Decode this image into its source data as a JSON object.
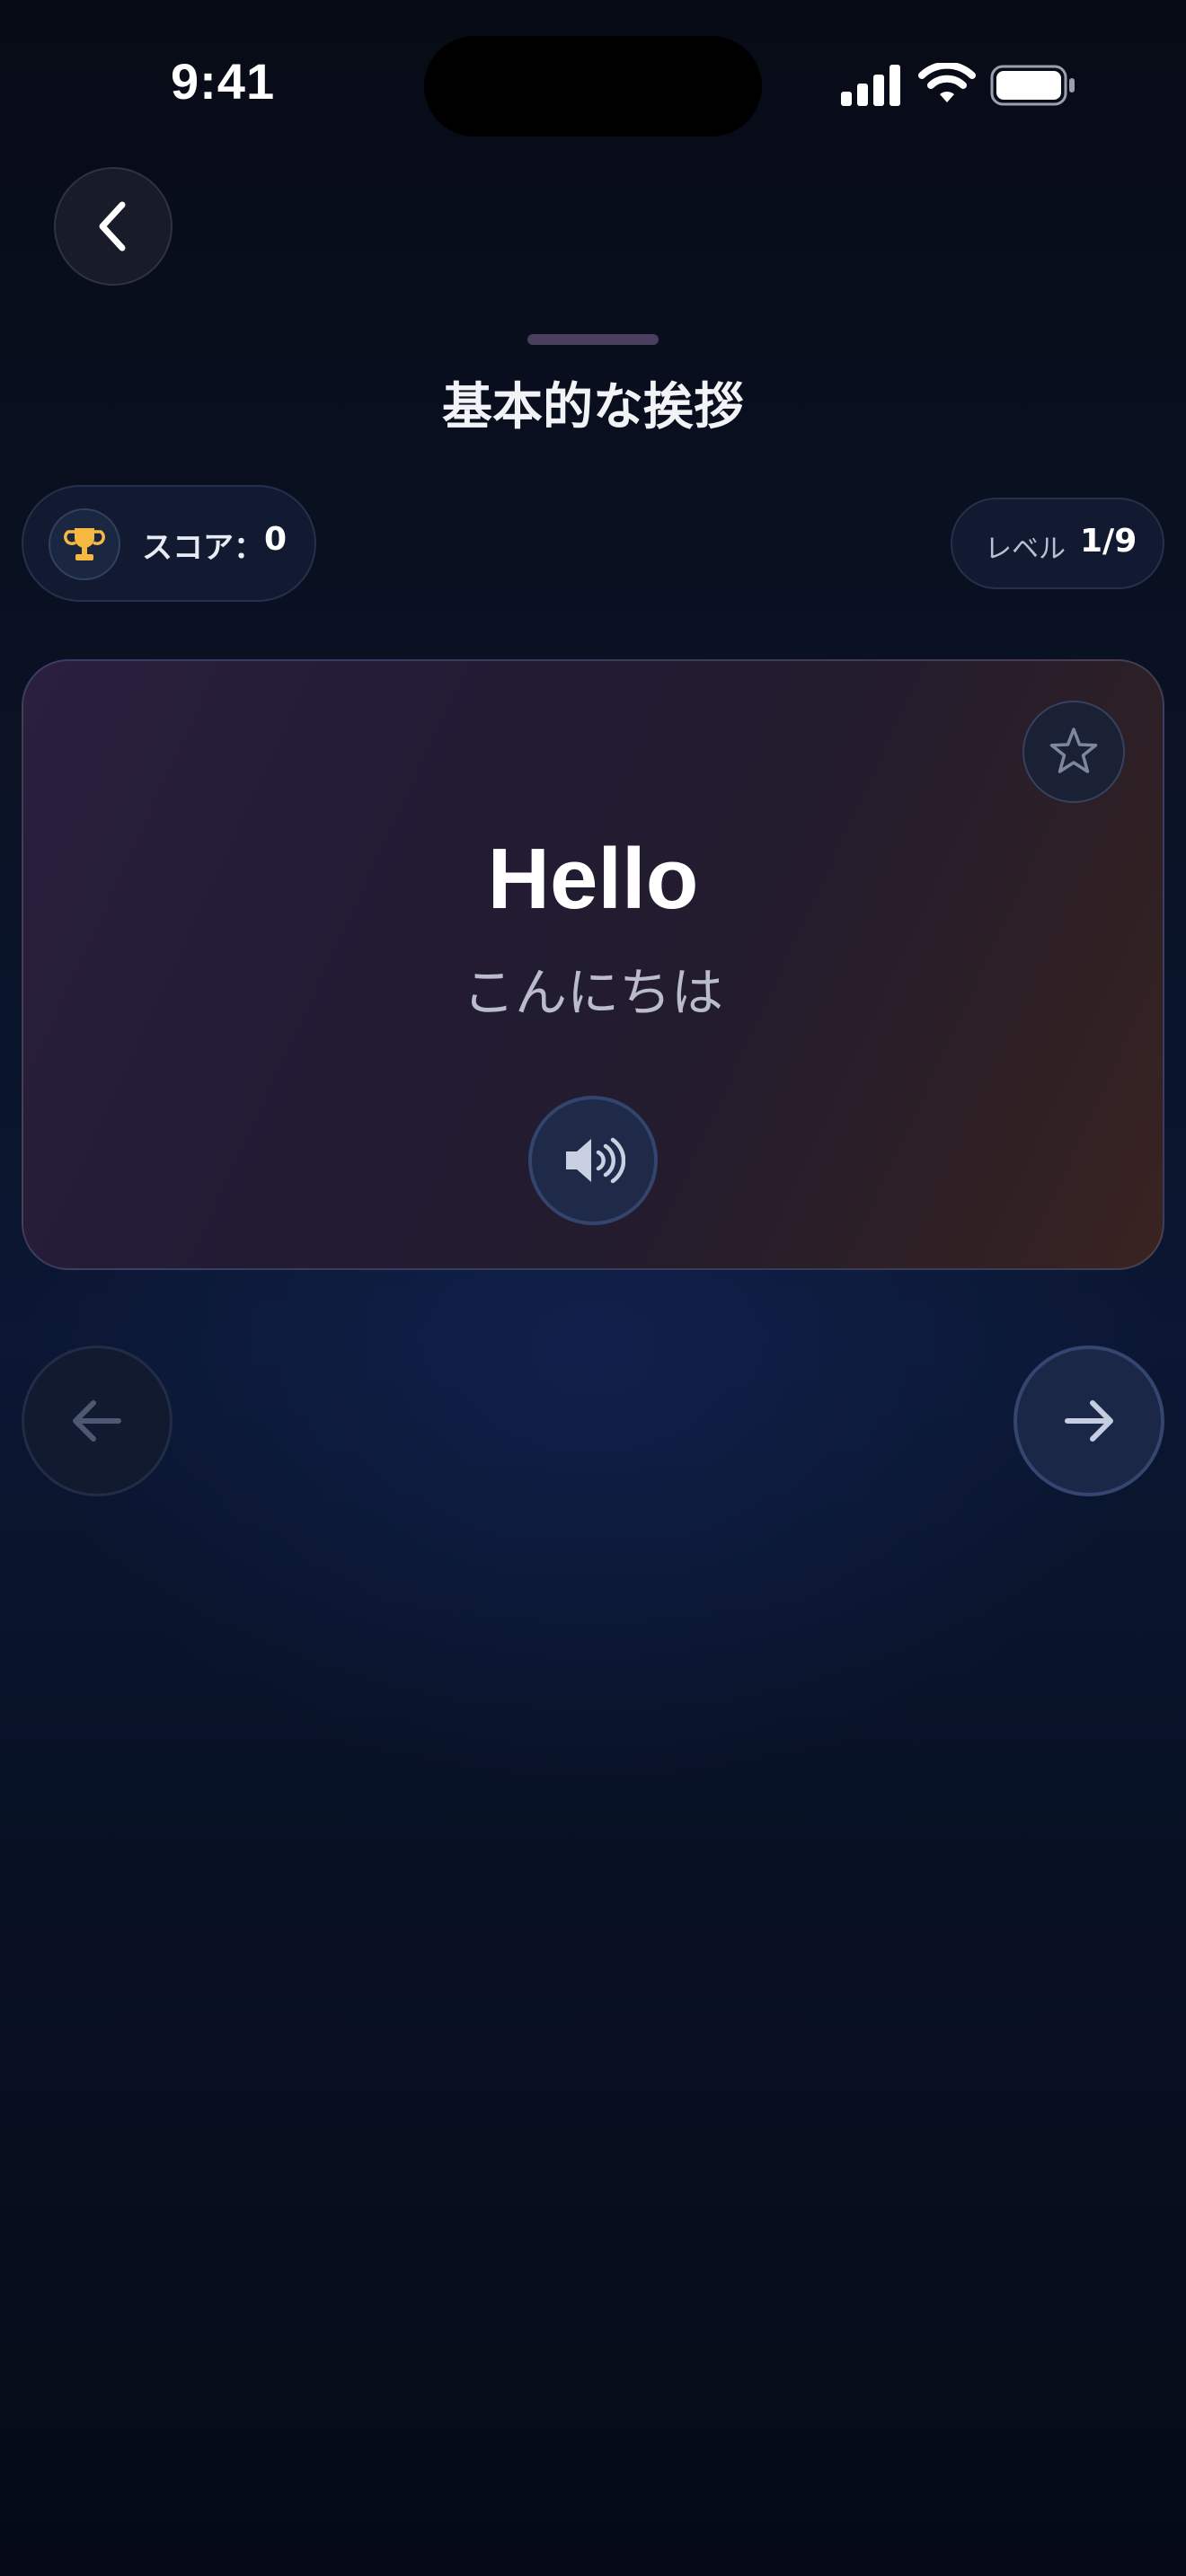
{
  "status_bar": {
    "time": "9:41",
    "icons": [
      "cellular-signal-icon",
      "wifi-icon",
      "battery-icon"
    ]
  },
  "header": {
    "back_icon": "chevron-left-icon",
    "title": "基本的な挨拶"
  },
  "score": {
    "icon": "trophy-icon",
    "label": "スコア：",
    "value": "0"
  },
  "level": {
    "label": "レベル",
    "value": "1/9"
  },
  "card": {
    "word": "Hello",
    "translation": "こんにちは",
    "favorite_icon": "star-outline-icon",
    "audio_icon": "speaker-icon"
  },
  "navigation": {
    "prev_icon": "arrow-left-icon",
    "next_icon": "arrow-right-icon"
  },
  "colors": {
    "background": "#0a1224",
    "card_start": "#2a1f3d",
    "card_end": "#3a2321",
    "trophy": "#f5b942",
    "accent_ring": "#34456d"
  }
}
